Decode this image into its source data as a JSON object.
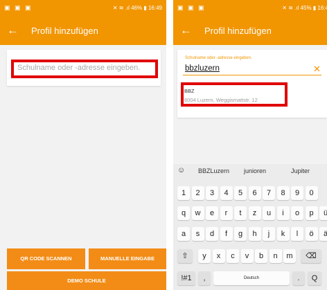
{
  "left_screen": {
    "status": {
      "left_icons": "▣ ▣ ▣",
      "right": "✕ ≋ .ıl 46% ▮ 16:49"
    },
    "appbar": {
      "back_icon": "arrow-left-icon",
      "title": "Profil hinzufügen"
    },
    "search": {
      "placeholder": "Schulname oder -adresse eingeben."
    },
    "buttons": {
      "qr": "QR CODE SCANNEN",
      "manual": "MANUELLE EINGABE",
      "demo": "DEMO SCHULE"
    }
  },
  "right_screen": {
    "status": {
      "left_icons": "▣ ▣ ▣",
      "right": "✕ ≋ .ıl 45% ▮ 16:4"
    },
    "appbar": {
      "back_icon": "arrow-left-icon",
      "title": "Profil hinzufügen"
    },
    "search": {
      "label": "Schulname oder -adresse eingeben.",
      "value": "bbzluzern",
      "clear": "✕"
    },
    "suggestion": {
      "name": "BBZ",
      "address": "6004 Luzern, Weggismattstr. 12"
    },
    "keyboard": {
      "suggestions": [
        "BBZLuzern",
        "junioren",
        "Jupiter"
      ],
      "row1": [
        "1",
        "2",
        "3",
        "4",
        "5",
        "6",
        "7",
        "8",
        "9",
        "0"
      ],
      "row2": [
        "q",
        "w",
        "e",
        "r",
        "t",
        "z",
        "u",
        "i",
        "o",
        "p",
        "ü"
      ],
      "row3": [
        "a",
        "s",
        "d",
        "f",
        "g",
        "h",
        "j",
        "k",
        "l",
        "ö",
        "ä"
      ],
      "row4": [
        "y",
        "x",
        "c",
        "v",
        "b",
        "n",
        "m"
      ],
      "shift": "⇧",
      "backspace": "⌫",
      "symbols": "!#1",
      "comma": ",",
      "space": "Deutsch",
      "period": ".",
      "search": "Q"
    }
  },
  "colors": {
    "accent": "#f19500",
    "button": "#f28c17",
    "highlight": "#e00000"
  }
}
